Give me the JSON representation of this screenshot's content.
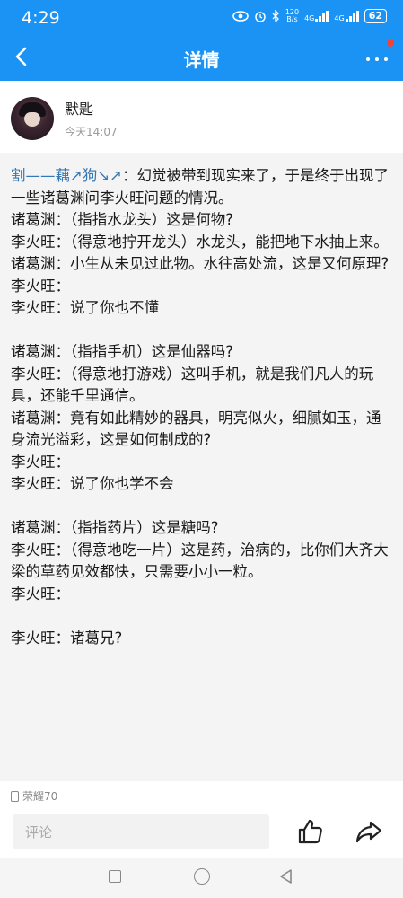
{
  "status_bar": {
    "time": "4:29",
    "net_speed_value": "120",
    "net_speed_unit": "B/s",
    "signal1": "4G",
    "signal2": "4G",
    "battery": "62"
  },
  "header": {
    "title": "详情"
  },
  "author": {
    "name": "默匙",
    "date": "今天14:07"
  },
  "post": {
    "nick": "割——藕↗狗↘↗",
    "intro": "：幻觉被带到现实来了，于是终于出现了一些诸葛渊问李火旺问题的情况。",
    "lines": [
      "诸葛渊：（指指水龙头）这是何物?",
      "李火旺：（得意地拧开龙头）水龙头，能把地下水抽上来。",
      "诸葛渊：小生从未见过此物。水往高处流，这是又何原理?",
      "李火旺：",
      "李火旺：说了你也不懂",
      "",
      "诸葛渊：（指指手机）这是仙器吗?",
      "李火旺：（得意地打游戏）这叫手机，就是我们凡人的玩具，还能千里通信。",
      "诸葛渊：竟有如此精妙的器具，明亮似火，细腻如玉，通身流光溢彩，这是如何制成的?",
      "李火旺：",
      "李火旺：说了你也学不会",
      "",
      "诸葛渊：（指指药片）这是糖吗?",
      "李火旺：（得意地吃一片）这是药，治病的，比你们大齐大梁的草药见效都快，只需要小小一粒。",
      "李火旺：",
      "",
      "李火旺：诸葛兄?"
    ]
  },
  "device": "荣耀70",
  "bottom": {
    "comment_placeholder": "评论"
  },
  "colors": {
    "accent": "#1b93f5",
    "nick": "#3475b5",
    "badge": "#f44336"
  }
}
